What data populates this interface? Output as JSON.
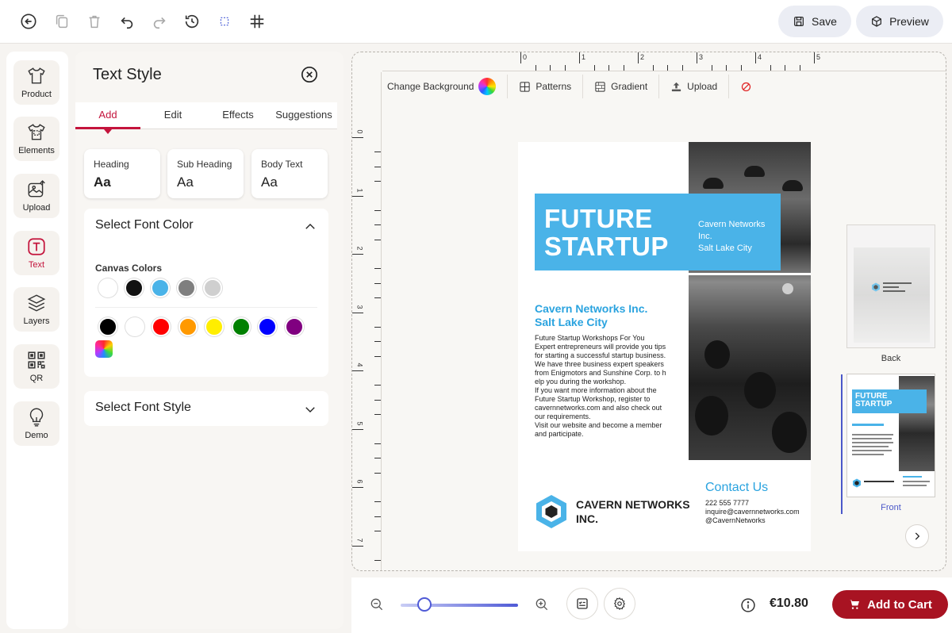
{
  "header": {
    "save_label": "Save",
    "preview_label": "Preview"
  },
  "rail": {
    "items": [
      {
        "label": "Product",
        "icon": "tshirt-icon"
      },
      {
        "label": "Elements",
        "icon": "elements-icon"
      },
      {
        "label": "Upload",
        "icon": "upload-image-icon"
      },
      {
        "label": "Text",
        "icon": "text-icon"
      },
      {
        "label": "Layers",
        "icon": "layers-icon"
      },
      {
        "label": "QR",
        "icon": "qr-icon"
      },
      {
        "label": "Demo",
        "icon": "lightbulb-icon"
      }
    ],
    "active": "Text"
  },
  "panel": {
    "title": "Text Style",
    "tabs": [
      "Add",
      "Edit",
      "Effects",
      "Suggestions"
    ],
    "active_tab": "Add",
    "text_presets": [
      {
        "label": "Heading",
        "sample": "Aa"
      },
      {
        "label": "Sub Heading",
        "sample": "Aa"
      },
      {
        "label": "Body Text",
        "sample": "Aa"
      }
    ],
    "font_color": {
      "title": "Select Font Color",
      "canvas_colors_label": "Canvas Colors",
      "canvas_colors": [
        "#ffffff",
        "#111111",
        "#4ab3e8",
        "#7f7f7f",
        "#cfcfcf"
      ],
      "palette": [
        "#000000",
        "#ffffff",
        "#ff0000",
        "#ff9900",
        "#ffee00",
        "#008000",
        "#0000ff",
        "#800080"
      ]
    },
    "font_style": {
      "title": "Select Font Style"
    }
  },
  "canvas": {
    "toolbar": {
      "change_background": "Change Background",
      "patterns": "Patterns",
      "gradient": "Gradient",
      "upload": "Upload"
    },
    "ruler_top": [
      "0",
      "1",
      "2",
      "3",
      "4",
      "5"
    ],
    "ruler_left": [
      "0",
      "1",
      "2",
      "3",
      "4",
      "5",
      "6",
      "7"
    ]
  },
  "flyer": {
    "title_line1": "FUTURE",
    "title_line2": "STARTUP",
    "banner_sub_line1": "Cavern Networks",
    "banner_sub_line2": "Inc.",
    "banner_sub_line3": "Salt Lake City",
    "heading_line1": "Cavern Networks Inc.",
    "heading_line2": "Salt Lake City",
    "body_lines": [
      "Future Startup Workshops For You",
      "Expert entrepreneurs will provide you tips",
      "for starting a successful startup business.",
      "We have three business expert speakers",
      "from Enigmotors and Sunshine Corp. to h",
      "elp you during the workshop.",
      "If you want more information about the",
      "Future Startup Workshop, register to",
      "cavernnetworks.com and also check out",
      "our requirements.",
      "Visit our website and become a member",
      "and participate."
    ],
    "contact_title": "Contact Us",
    "contact_phone": "222 555 7777",
    "contact_email": "inquire@cavernnetworks.com",
    "contact_social": "@CavernNetworks",
    "logo_line1": "CAVERN NETWORKS",
    "logo_line2": "INC.",
    "accent_color": "#4ab3e8"
  },
  "pages": {
    "back_label": "Back",
    "front_label": "Front",
    "active": "Front"
  },
  "footer": {
    "price": "€10.80",
    "add_to_cart": "Add to Cart",
    "zoom_level": 0.2
  }
}
